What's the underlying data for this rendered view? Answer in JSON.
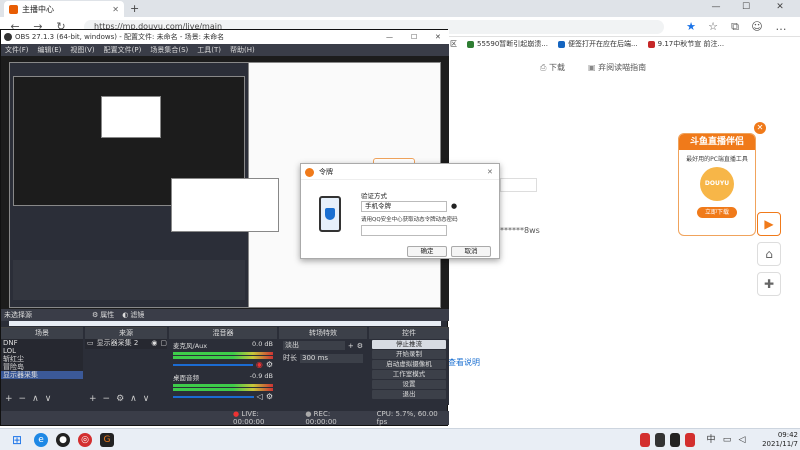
{
  "browser": {
    "tab_title": "主播中心",
    "url": "https://mp.douyu.com/live/main",
    "bookmarks": [
      "区",
      "55590暂断引起崩溃...",
      "便签打开在应在后端...",
      "9.17中秋节宣 前注..."
    ],
    "page_links": [
      "下载",
      "弃阅读喵指南"
    ],
    "masked_text": "******8ws",
    "bottom_link": "查看说明"
  },
  "ad": {
    "title": "斗鱼直播伴侣",
    "subtitle": "最好用的PC端直播工具",
    "brand": "DOUYU",
    "button": "立即下载",
    "accent": "#f07a1a"
  },
  "obs": {
    "title": "OBS 27.1.3 (64-bit, windows) - 配置文件: 未命名 - 场景: 未命名",
    "menu": [
      "文件(F)",
      "编辑(E)",
      "视图(V)",
      "配置文件(P)",
      "场景集合(S)",
      "工具(T)",
      "帮助(H)"
    ],
    "no_source": "未选择源",
    "properties": "属性",
    "filters": "滤镜",
    "docks": {
      "scenes": {
        "title": "场景",
        "items": [
          "DNF",
          "LOL",
          "斩红尘",
          "冒险岛",
          "显示器采集"
        ]
      },
      "sources": {
        "title": "来源",
        "items": [
          "显示器采集 2"
        ]
      },
      "mixer": {
        "title": "混音器",
        "channels": [
          {
            "name": "麦克风/Aux",
            "db": "0.0 dB"
          },
          {
            "name": "桌面音频",
            "db": "-0.9 dB"
          }
        ]
      },
      "transitions": {
        "title": "转场特效",
        "type": "淡出",
        "duration_label": "时长",
        "duration": "300 ms"
      },
      "controls": {
        "title": "控件",
        "buttons": [
          "停止推流",
          "开始录制",
          "启动虚拟摄像机",
          "工作室模式",
          "设置",
          "退出"
        ]
      }
    },
    "statusbar": {
      "live": "LIVE: 00:00:00",
      "rec": "REC: 00:00:00",
      "cpu": "CPU: 5.7%, 60.00 fps"
    }
  },
  "dialog": {
    "title": "令牌",
    "label": "验证方式",
    "method": "手机令牌",
    "hint": "请用QQ安全中心获取动态令牌动态密码",
    "ok": "确定",
    "cancel": "取消"
  },
  "taskbar": {
    "time": "09:42",
    "date": "2021/11/7",
    "ime": "中"
  }
}
